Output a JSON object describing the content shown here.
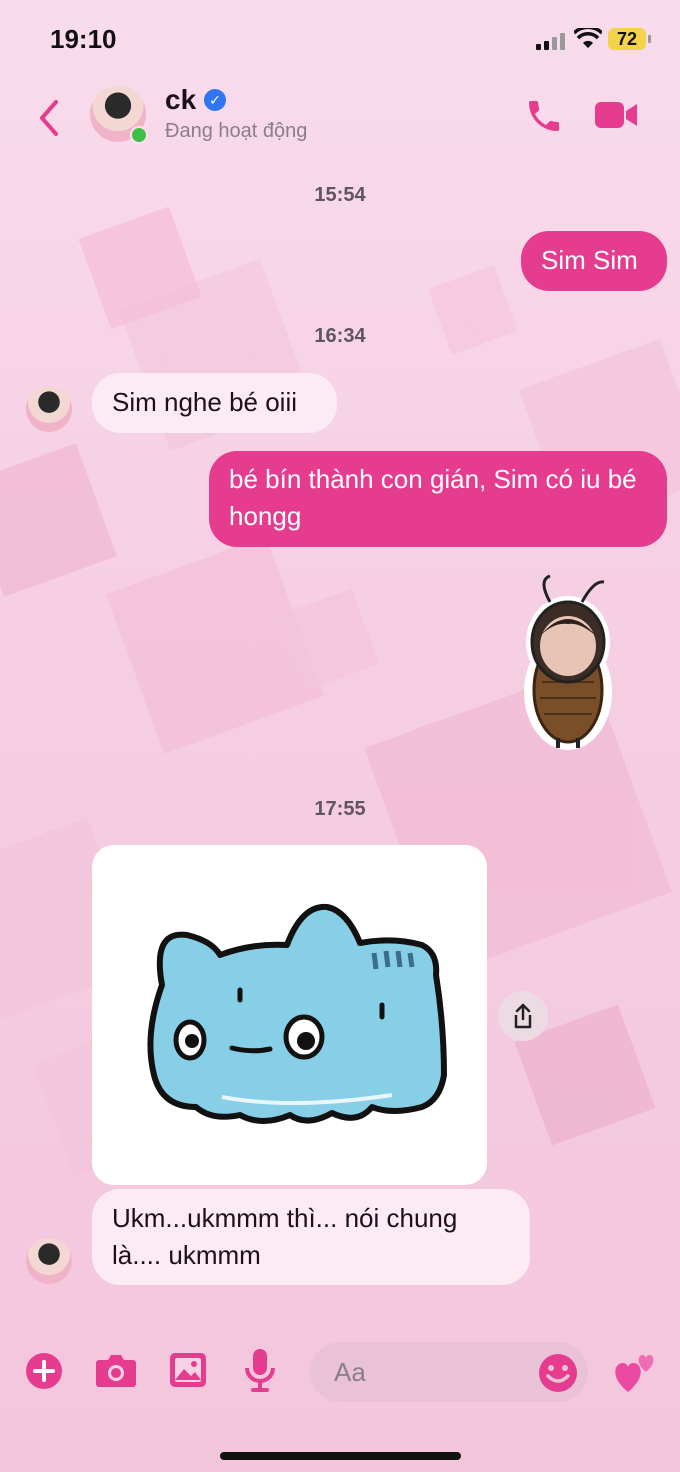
{
  "status_bar": {
    "time": "19:10",
    "battery": "72"
  },
  "header": {
    "name": "ck",
    "status": "Đang hoạt động"
  },
  "messages": {
    "time1": "15:54",
    "m1": "Sim Sim",
    "time2": "16:34",
    "m2": "Sim nghe bé oiii",
    "m3": "bé bín thành con gián, Sim có iu bé hongg",
    "time3": "17:55",
    "m4": "Ukm...ukmmm thì... nói chung là.... ukmmm"
  },
  "composer": {
    "placeholder": "Aa"
  },
  "icons": [
    "back-icon",
    "phone-icon",
    "video-camera-icon",
    "share-icon",
    "plus-icon",
    "camera-icon",
    "image-icon",
    "microphone-icon",
    "smile-icon",
    "hearts-icon"
  ],
  "colors": {
    "accent": "#e63c8f",
    "background": "#f6d2e4"
  }
}
